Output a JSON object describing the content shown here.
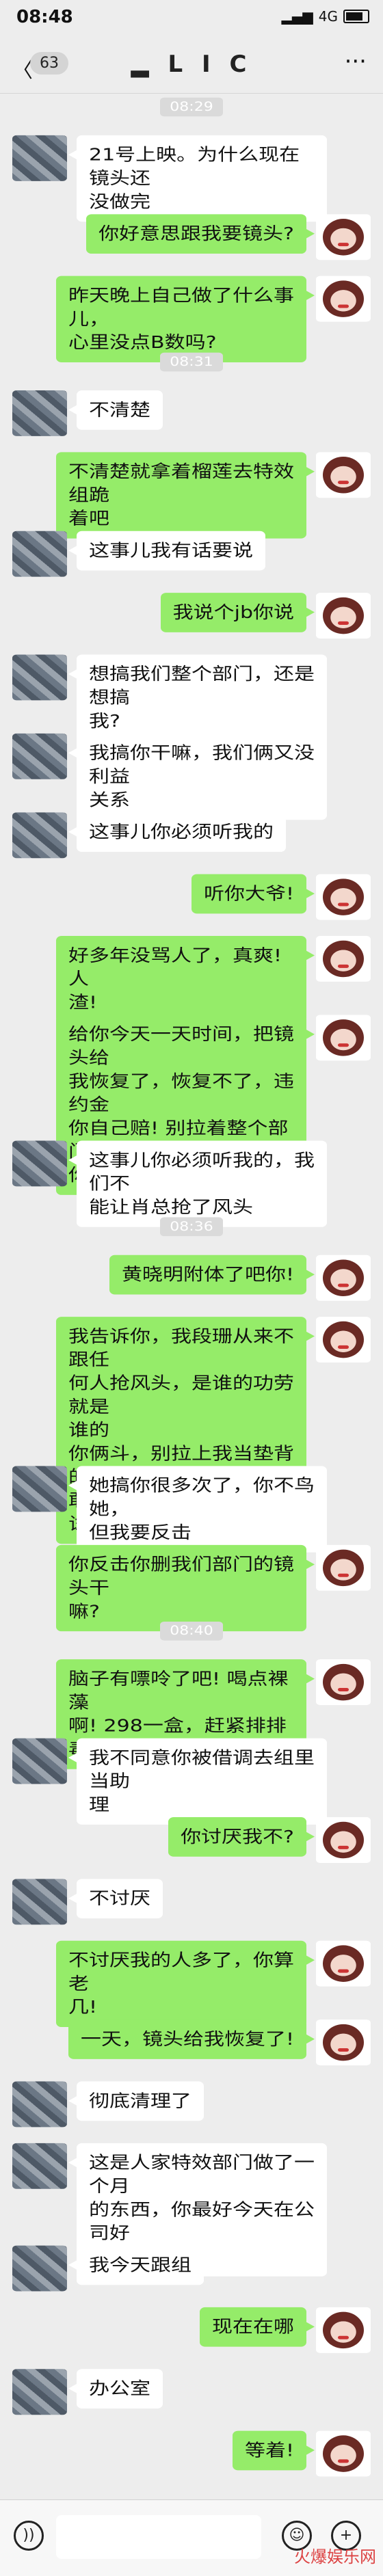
{
  "status_bar": {
    "time": "08:48",
    "network": "4G"
  },
  "header": {
    "back_label": "〈",
    "unread_count": "63",
    "title": "▂ L I C",
    "more_label": "···"
  },
  "chat": [
    {
      "type": "time",
      "text": "08:29"
    },
    {
      "type": "msg",
      "side": "left",
      "text": "21号上映。为什么现在镜头还\n没做完"
    },
    {
      "type": "msg",
      "side": "right",
      "text": "你好意思跟我要镜头?"
    },
    {
      "type": "msg",
      "side": "right",
      "text": "昨天晚上自己做了什么事儿，\n心里没点B数吗?"
    },
    {
      "type": "time",
      "text": "08:31"
    },
    {
      "type": "msg",
      "side": "left",
      "text": "不清楚"
    },
    {
      "type": "msg",
      "side": "right",
      "text": "不清楚就拿着榴莲去特效组跪\n着吧"
    },
    {
      "type": "msg",
      "side": "left",
      "text": "这事儿我有话要说"
    },
    {
      "type": "msg",
      "side": "right",
      "text": "我说个jb你说"
    },
    {
      "type": "msg",
      "side": "left",
      "text": "想搞我们整个部门，还是想搞\n我?"
    },
    {
      "type": "msg",
      "side": "left",
      "text": "我搞你干嘛，我们俩又没利益\n关系"
    },
    {
      "type": "msg",
      "side": "left",
      "text": "这事儿你必须听我的"
    },
    {
      "type": "msg",
      "side": "right",
      "text": "听你大爷!"
    },
    {
      "type": "msg",
      "side": "right",
      "text": "好多年没骂人了，真爽! 人\n渣!"
    },
    {
      "type": "msg",
      "side": "right",
      "text": "给你今天一天时间，把镜头给\n我恢复了，恢复不了，违约金\n你自己赔! 别拉着整个部门给\n你当垫背的"
    },
    {
      "type": "msg",
      "side": "left",
      "text": "这事儿你必须听我的，我们不\n能让肖总抢了风头"
    },
    {
      "type": "time",
      "text": "08:36"
    },
    {
      "type": "msg",
      "side": "right",
      "text": "黄晓明附体了吧你!"
    },
    {
      "type": "msg",
      "side": "right",
      "text": "我告诉你，我段珊从来不跟任\n何人抢风头，是谁的功劳就是\n谁的\n你俩斗，别拉上我当垫背的。\n敢动我的人一下，你试试!"
    },
    {
      "type": "msg",
      "side": "left",
      "text": "她搞你很多次了，你不鸟她，\n但我要反击"
    },
    {
      "type": "msg",
      "side": "right",
      "text": "你反击你删我们部门的镜头干\n嘛?"
    },
    {
      "type": "time",
      "text": "08:40"
    },
    {
      "type": "msg",
      "side": "right",
      "text": "脑子有嘌呤了吧! 喝点裸藻\n啊! 298一盒，赶紧排排毒"
    },
    {
      "type": "msg",
      "side": "left",
      "text": "我不同意你被借调去组里当助\n理"
    },
    {
      "type": "msg",
      "side": "right",
      "text": "你讨厌我不?"
    },
    {
      "type": "msg",
      "side": "left",
      "text": "不讨厌"
    },
    {
      "type": "msg",
      "side": "right",
      "text": "不讨厌我的人多了，你算老\n几!"
    },
    {
      "type": "msg",
      "side": "right",
      "text": "一天，镜头给我恢复了!"
    },
    {
      "type": "msg",
      "side": "left",
      "text": "彻底清理了"
    },
    {
      "type": "msg",
      "side": "left",
      "text": "这是人家特效部门做了一个月\n的东西，你最好今天在公司好\n好呆着"
    },
    {
      "type": "msg",
      "side": "left",
      "text": "我今天跟组"
    },
    {
      "type": "msg",
      "side": "right",
      "text": "现在在哪"
    },
    {
      "type": "msg",
      "side": "left",
      "text": "办公室"
    },
    {
      "type": "msg",
      "side": "right",
      "text": "等着!"
    }
  ],
  "input_bar": {
    "voice_icon": "))",
    "emoji_icon": "☺",
    "plus_icon": "+"
  },
  "watermark": "火爆娱乐网"
}
